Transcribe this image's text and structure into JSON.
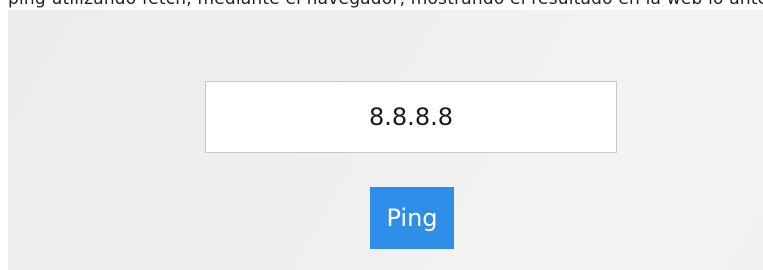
{
  "top_text": "ping utilizando fetch, mediante el navegador, mostrando el resultado en la web lo antes posible y mostrando el tiempo de respuesta y",
  "ping_form": {
    "ip_value": "8.8.8.8",
    "ping_label": "Ping"
  }
}
